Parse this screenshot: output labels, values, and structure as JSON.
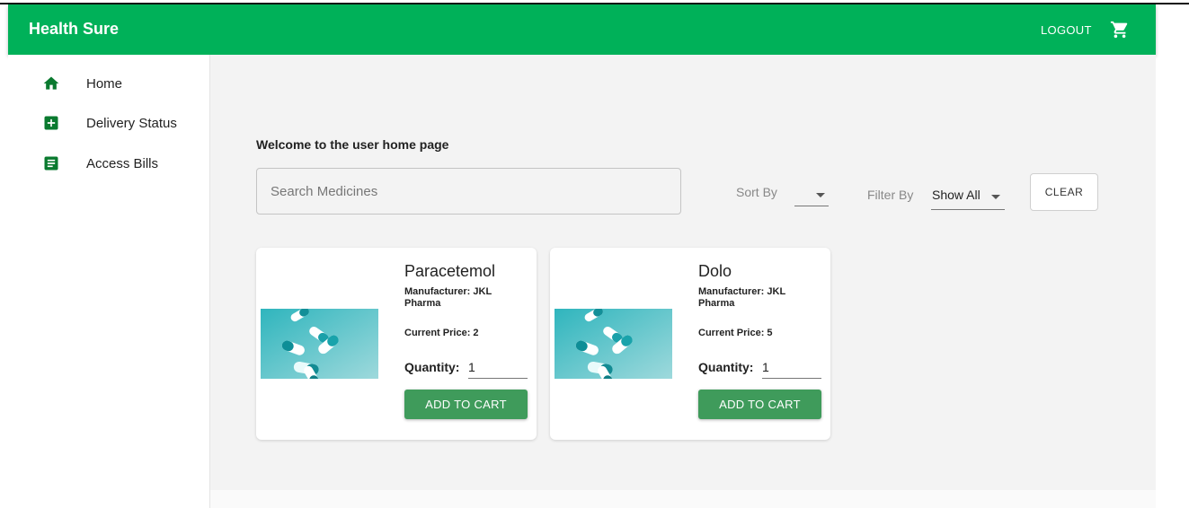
{
  "header": {
    "title": "Health Sure",
    "logout_label": "LOGOUT"
  },
  "sidebar": {
    "items": [
      {
        "label": "Home",
        "icon": "home-icon"
      },
      {
        "label": "Delivery Status",
        "icon": "medical-plus-icon"
      },
      {
        "label": "Access Bills",
        "icon": "bill-icon"
      }
    ]
  },
  "main": {
    "welcome": "Welcome to the user home page",
    "search_placeholder": "Search Medicines",
    "sort_label": "Sort By",
    "sort_value": "",
    "filter_label": "Filter By",
    "filter_value": "Show All",
    "clear_label": "CLEAR"
  },
  "products": [
    {
      "name": "Paracetemol",
      "manufacturer": "Manufacturer: JKL Pharma",
      "price": "Current Price: 2",
      "quantity_label": "Quantity:",
      "quantity": "1",
      "add_label": "ADD TO CART",
      "image": "pills-image"
    },
    {
      "name": "Dolo",
      "manufacturer": "Manufacturer: JKL Pharma",
      "price": "Current Price: 5",
      "quantity_label": "Quantity:",
      "quantity": "1",
      "add_label": "ADD TO CART",
      "image": "pills-image"
    }
  ],
  "colors": {
    "appbar": "#00b159",
    "icon_green": "#0a7a2f",
    "button_green": "#3f9b5b",
    "main_bg": "#f3f3f3"
  }
}
